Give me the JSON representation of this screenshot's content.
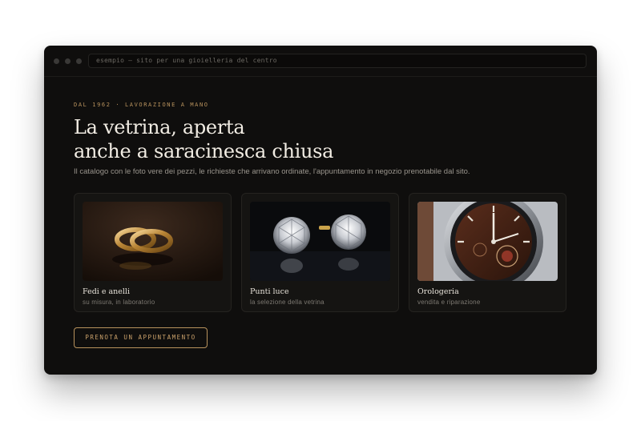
{
  "browser": {
    "address_text": "esempio — sito per una gioielleria del centro"
  },
  "hero": {
    "eyebrow": "DAL 1962 · LAVORAZIONE A MANO",
    "headline_line1": "La vetrina, aperta",
    "headline_line2": "anche a saracinesca chiusa",
    "subtitle": "Il catalogo con le foto vere dei pezzi, le richieste che arrivano ordinate, l'appuntamento in negozio prenotabile dal sito."
  },
  "cards": [
    {
      "title": "Fedi e anelli",
      "subtitle": "su misura, in laboratorio"
    },
    {
      "title": "Punti luce",
      "subtitle": "la selezione della vetrina"
    },
    {
      "title": "Orologeria",
      "subtitle": "vendita e riparazione"
    }
  ],
  "cta": {
    "label": "PRENOTA UN APPUNTAMENTO"
  },
  "colors": {
    "background": "#0f0e0d",
    "accent_gold": "#b8925d",
    "text_light": "#f1ece3",
    "text_muted": "#9a958d"
  }
}
